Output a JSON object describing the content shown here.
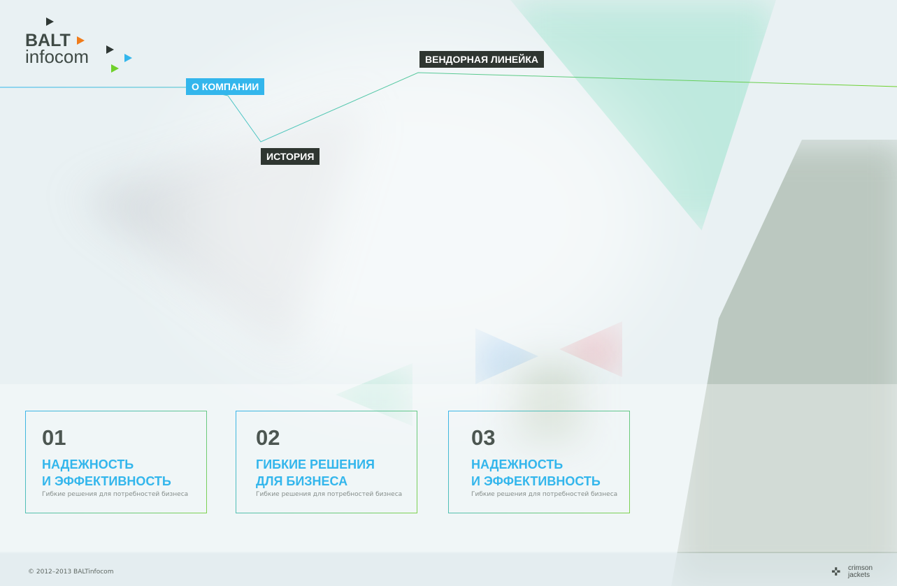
{
  "brand": {
    "line1": "BALT",
    "line2": "infocom",
    "colors": {
      "dark": "#2f3834",
      "orange": "#f07c1a",
      "blue": "#33b6ec",
      "green": "#6fd12a"
    }
  },
  "nav": {
    "items": [
      {
        "label": "О КОМПАНИИ",
        "active": true
      },
      {
        "label": "ИСТОРИЯ",
        "active": false
      },
      {
        "label": "ВЕНДОРНАЯ ЛИНЕЙКА",
        "active": false
      }
    ]
  },
  "features": [
    {
      "number": "01",
      "title_line1": "НАДЕЖНОСТЬ",
      "title_line2": "И ЭФФЕКТИВНОСТЬ",
      "subtitle": "Гибкие решения для потребностей бизнеса"
    },
    {
      "number": "02",
      "title_line1": "ГИБКИЕ РЕШЕНИЯ",
      "title_line2": "ДЛЯ БИЗНЕСА",
      "subtitle": "Гибкие решения для потребностей бизнеса"
    },
    {
      "number": "03",
      "title_line1": "НАДЕЖНОСТЬ",
      "title_line2": "И ЭФФЕКТИВНОСТЬ",
      "subtitle": "Гибкие решения для потребностей бизнеса"
    }
  ],
  "footer": {
    "copyright": "© 2012–2013 BALTinfocom",
    "credit_line1": "crimson",
    "credit_line2": "jackets",
    "credit_icon": "crosshair-logo-icon"
  },
  "colors": {
    "accent": "#33b6ec",
    "dark_tag": "#2f3631",
    "green": "#7ed24e"
  }
}
